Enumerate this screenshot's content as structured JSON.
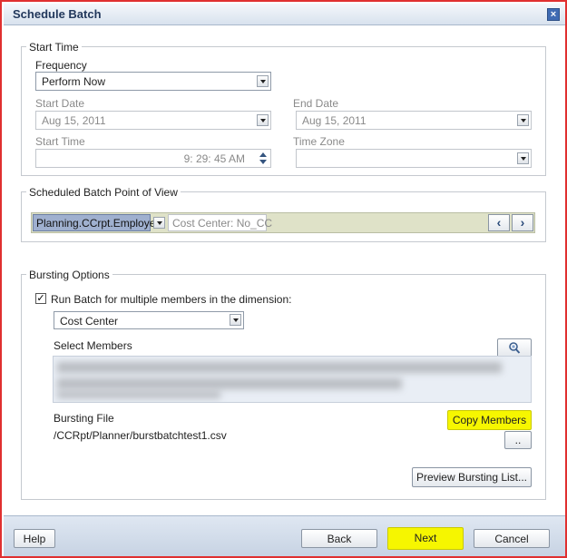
{
  "window": {
    "title": "Schedule Batch",
    "close_glyph": "×"
  },
  "start_time": {
    "legend": "Start Time",
    "frequency_label": "Frequency",
    "frequency_value": "Perform Now",
    "start_date_label": "Start Date",
    "start_date_value": "Aug 15, 2011",
    "end_date_label": "End Date",
    "end_date_value": "Aug 15, 2011",
    "start_time_label": "Start Time",
    "start_time_value": "9: 29: 45 AM",
    "time_zone_label": "Time Zone",
    "time_zone_value": ""
  },
  "pov": {
    "legend": "Scheduled Batch Point of View",
    "dimension": "Planning.CCrpt.Employee",
    "member": "Cost Center: No_CC",
    "prev_glyph": "‹",
    "next_glyph": "›"
  },
  "bursting": {
    "legend": "Bursting Options",
    "run_batch_label": "Run Batch for multiple members in the dimension:",
    "run_batch_checked": true,
    "dimension_value": "Cost Center",
    "select_members_label": "Select Members",
    "bursting_file_label": "Bursting File",
    "bursting_file_value": "/CCRpt/Planner/burstbatchtest1.csv",
    "copy_members_label": "Copy Members",
    "browse_label": "..",
    "preview_label": "Preview Bursting List..."
  },
  "footer": {
    "help_label": "Help",
    "back_label": "Back",
    "next_label": "Next",
    "cancel_label": "Cancel"
  },
  "colors": {
    "highlight": "#f6f600",
    "border_accent": "#e03030",
    "pov_dimension": "#9fb0cf",
    "pov_bar": "#dfe2c8"
  },
  "icons": [
    "close-icon",
    "dropdown-arrow-icon",
    "spinner-icon",
    "chevron-left-icon",
    "chevron-right-icon",
    "member-selector-icon",
    "checkbox-checked-icon"
  ]
}
